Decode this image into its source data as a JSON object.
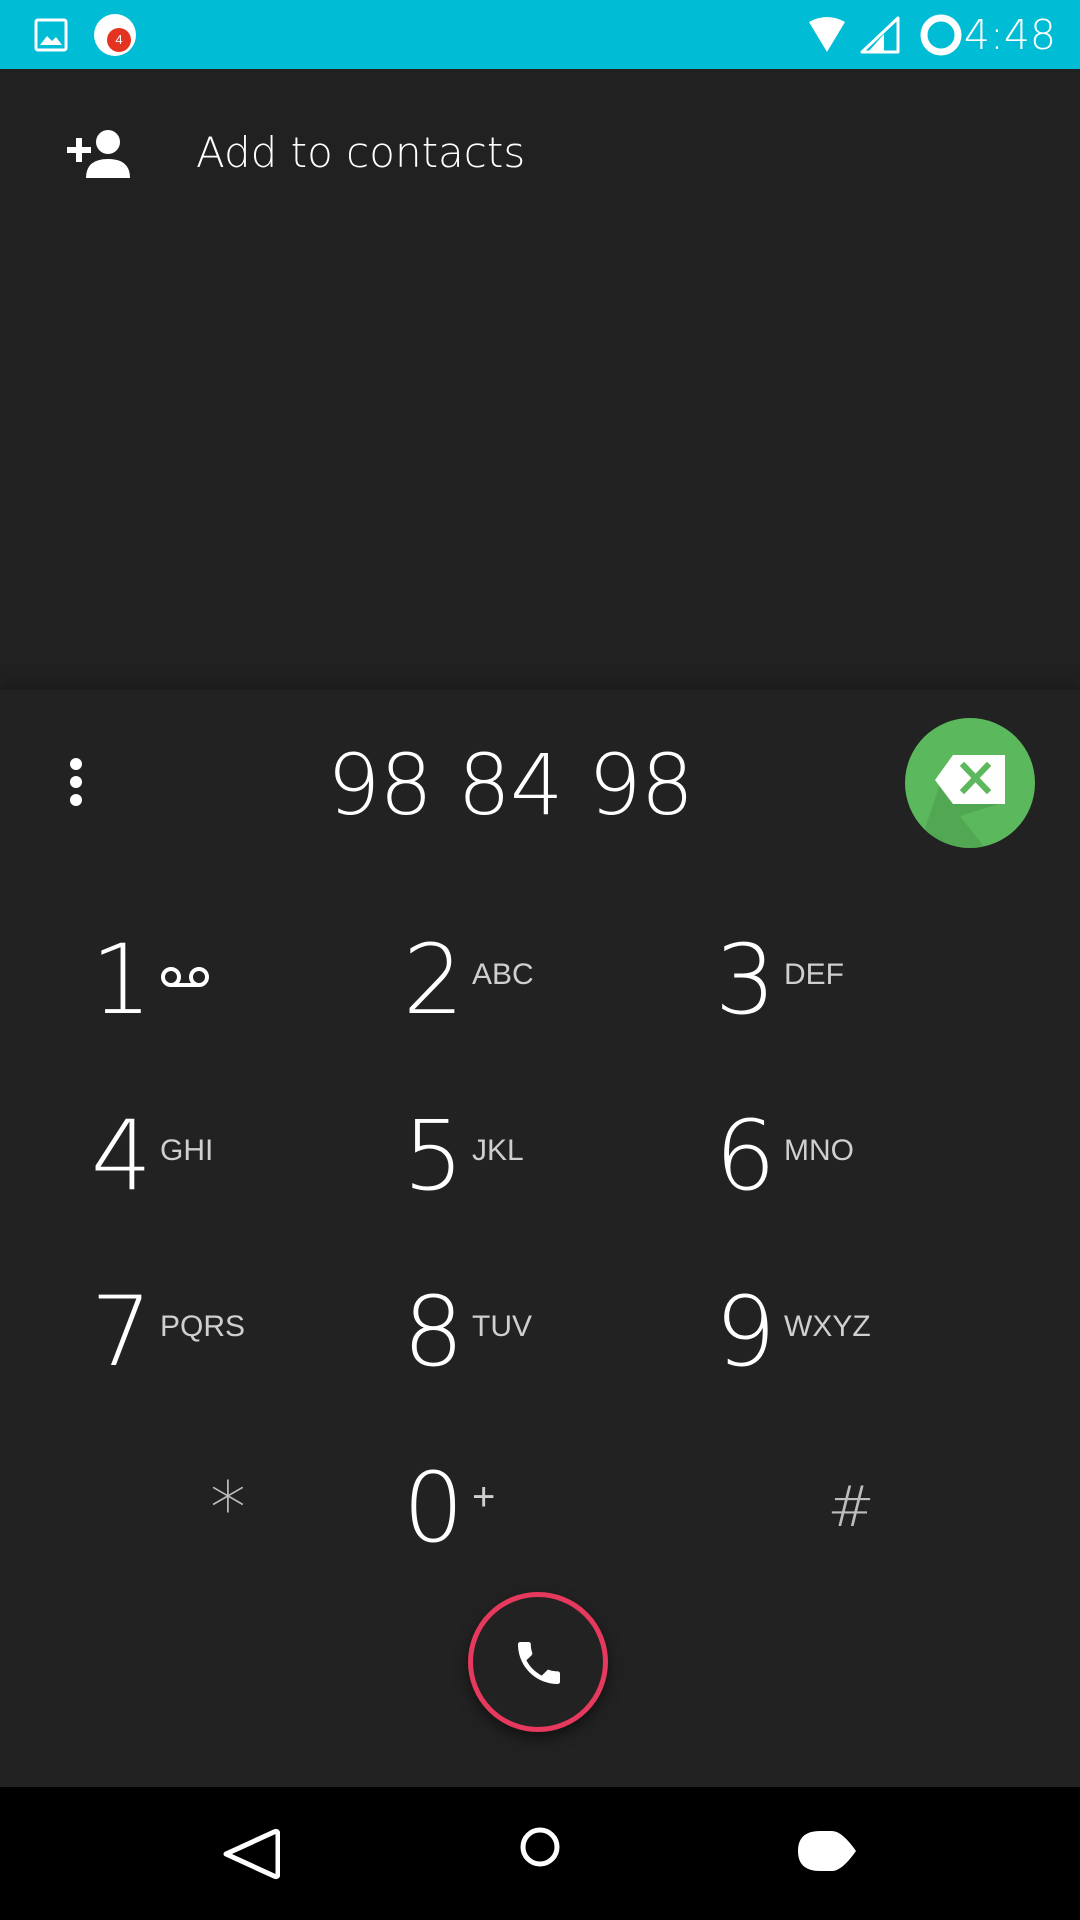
{
  "status_bar": {
    "time": "4:48",
    "background": "#00bcd4",
    "notification_badge": "4",
    "icons": [
      "gallery-icon",
      "notification-badge-icon",
      "wifi-icon",
      "cell-signal-icon",
      "battery-ring-icon"
    ]
  },
  "add_contact": {
    "label": "Add to contacts",
    "icon": "add-person-icon"
  },
  "dialer": {
    "digits": "98 84 98",
    "overflow_icon": "more-vert-icon",
    "backspace_icon": "backspace-icon",
    "backspace_color": "#5cb85c"
  },
  "keypad": {
    "k1": {
      "digit": "1",
      "icon": "voicemail-icon"
    },
    "k2": {
      "digit": "2",
      "letters": "ABC"
    },
    "k3": {
      "digit": "3",
      "letters": "DEF"
    },
    "k4": {
      "digit": "4",
      "letters": "GHI"
    },
    "k5": {
      "digit": "5",
      "letters": "JKL"
    },
    "k6": {
      "digit": "6",
      "letters": "MNO"
    },
    "k7": {
      "digit": "7",
      "letters": "PQRS"
    },
    "k8": {
      "digit": "8",
      "letters": "TUV"
    },
    "k9": {
      "digit": "9",
      "letters": "WXYZ"
    },
    "kstar": {
      "symbol": "*"
    },
    "k0": {
      "digit": "0",
      "letters": "+"
    },
    "khash": {
      "symbol": "#"
    }
  },
  "call": {
    "icon": "phone-icon",
    "ring_color": "#e5395d"
  },
  "nav_bar": {
    "icons": [
      "back-icon",
      "home-icon",
      "recents-icon"
    ]
  }
}
